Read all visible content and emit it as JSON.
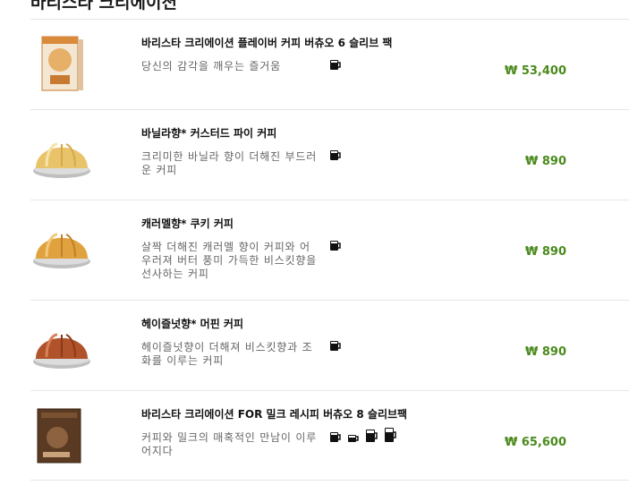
{
  "section": {
    "title": "바리스타 크리에이션"
  },
  "products": [
    {
      "name": "바리스타 크리에이션 플레이버 커피 버츄오 6 슬리브 팩",
      "description": "당신의 감각을 깨우는 즐거움",
      "price": "₩ 53,400",
      "image": "flavored-coffee-box",
      "cups": [
        "coffee-mug-icon"
      ]
    },
    {
      "name": "바닐라향* 커스터드 파이 커피",
      "description": "크리미한 바닐라 향이 더해진 부드러운 커피",
      "price": "₩ 890",
      "image": "vanilla-capsule",
      "cups": [
        "coffee-mug-icon"
      ]
    },
    {
      "name": "캐러멜향* 쿠키 커피",
      "description": "살짝 더해진 캐러멜 향이 커피와 어우러져 버터 풍미 가득한 비스킷향을 선사하는 커피",
      "price": "₩ 890",
      "image": "caramel-capsule",
      "cups": [
        "coffee-mug-icon"
      ]
    },
    {
      "name": "헤이즐넛향* 머핀 커피",
      "description": "헤이즐넛향이 더해져 비스킷향과 조화를 이루는 커피",
      "price": "₩ 890",
      "image": "hazelnut-capsule",
      "cups": [
        "coffee-mug-icon"
      ]
    },
    {
      "name": "바리스타 크리에이션 FOR 밀크 레시피 버츄오 8 슬리브팩",
      "description": "커피와 밀크의 매혹적인 만남이 이루어지다",
      "price": "₩ 65,600",
      "image": "milk-recipe-box",
      "cups": [
        "coffee-mug-icon",
        "espresso-cup-icon",
        "latte-glass-icon",
        "cappuccino-glass-icon"
      ]
    }
  ],
  "colors": {
    "price": "#4a8a1c",
    "divider": "#e6e6e6",
    "vanilla": "#e8c36a",
    "caramel": "#e0a23e",
    "hazelnut": "#b0522a",
    "box_orange": "#d98a3a",
    "box_brown": "#5a3a22"
  }
}
